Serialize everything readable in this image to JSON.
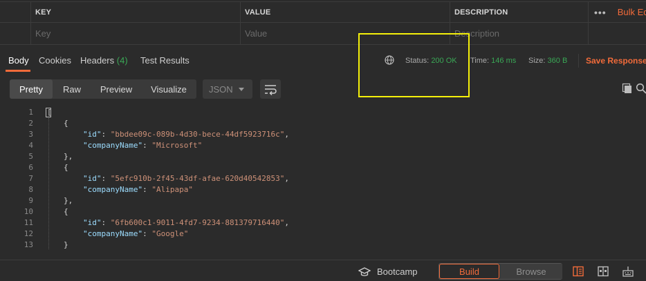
{
  "params": {
    "headers": {
      "key": "KEY",
      "value": "VALUE",
      "description": "DESCRIPTION"
    },
    "placeholders": {
      "key": "Key",
      "value": "Value",
      "description": "Description"
    },
    "more_icon": "more-horizontal-icon",
    "bulk_edit": "Bulk Edit"
  },
  "response": {
    "tabs": [
      {
        "label": "Body"
      },
      {
        "label": "Cookies"
      },
      {
        "label": "Headers",
        "count": "(4)"
      },
      {
        "label": "Test Results"
      }
    ],
    "status_label": "Status:",
    "status_value": "200 OK",
    "time_label": "Time:",
    "time_value": "146 ms",
    "size_label": "Size:",
    "size_value": "360 B",
    "save_response": "Save Response"
  },
  "toolbar": {
    "views": [
      "Pretty",
      "Raw",
      "Preview",
      "Visualize"
    ],
    "format": "JSON"
  },
  "code": {
    "line_numbers": [
      "1",
      "2",
      "3",
      "4",
      "5",
      "6",
      "7",
      "8",
      "9",
      "10",
      "11",
      "12",
      "13"
    ],
    "items": [
      {
        "id": "bbdee09c-089b-4d30-bece-44df5923716c",
        "companyName": "Microsoft"
      },
      {
        "id": "5efc910b-2f45-43df-afae-620d40542853",
        "companyName": "Alipapa"
      },
      {
        "id": "6fb600c1-9011-4fd7-9234-881379716440",
        "companyName": "Google"
      }
    ],
    "tokens": {
      "open": "[",
      "obj_open": "{",
      "obj_close_comma": "},",
      "obj_close": "}",
      "id_key": "\"id\"",
      "company_key": "\"companyName\"",
      "colon": ": ",
      "comma": ","
    }
  },
  "statusbar": {
    "bootcamp": "Bootcamp",
    "build": "Build",
    "browse": "Browse"
  },
  "colors": {
    "accent": "#f26b3a",
    "success": "#3aa856",
    "highlight": "#f5f10a",
    "json_key": "#9cdcfe",
    "json_string": "#ce9178"
  }
}
